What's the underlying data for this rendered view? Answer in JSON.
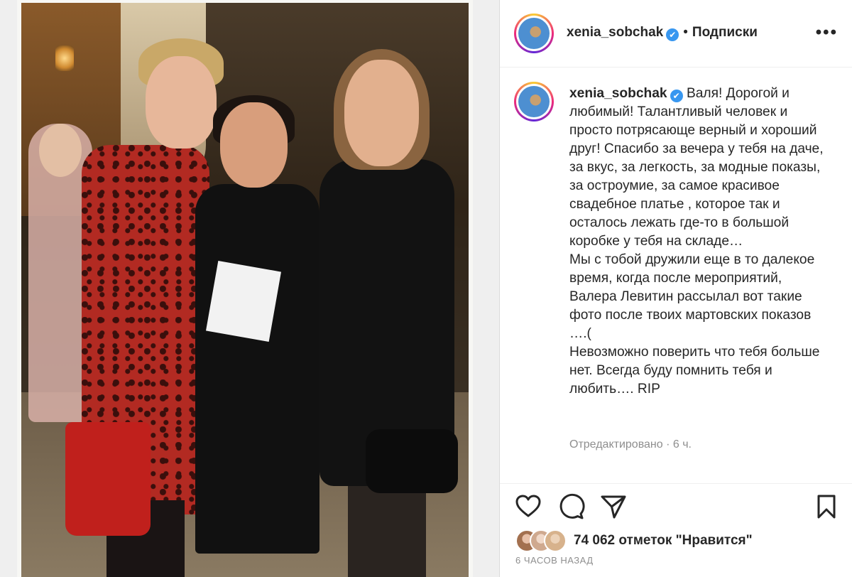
{
  "header": {
    "username": "xenia_sobchak",
    "verified_mark": "✔",
    "separator": "•",
    "follow_label": "Подписки",
    "more_label": "•••"
  },
  "caption": {
    "username": "xenia_sobchak",
    "verified_mark": "✔",
    "paragraph1": "Валя! Дорогой и любимый! Талантливый человек и просто потрясающе верный и хороший друг! Спасибо за вечера у тебя на даче, за вкус, за легкость, за модные показы, за остроумие, за самое красивое свадебное платье , которое так и осталось лежать где-то в большой коробке у тебя на складе…",
    "paragraph2": "Мы с тобой дружили еще в то далекое время, когда после мероприятий, Валера Левитин рассылал вот такие фото после твоих мартовских показов ….(",
    "paragraph3": "Невозможно поверить что тебя больше нет. Всегда буду помнить тебя и любить…. RIP",
    "meta": "Отредактировано · 6 ч."
  },
  "actions": {
    "icons": [
      "heart-icon",
      "comment-icon",
      "share-icon",
      "bookmark-icon"
    ],
    "likes_text": "74 062 отметок \"Нравится\"",
    "time_ago": "6 ЧАСОВ НАЗАД"
  },
  "colors": {
    "text": "#262626",
    "muted": "#8e8e8e",
    "verified": "#3897f0",
    "divider": "#dbdbdb"
  }
}
